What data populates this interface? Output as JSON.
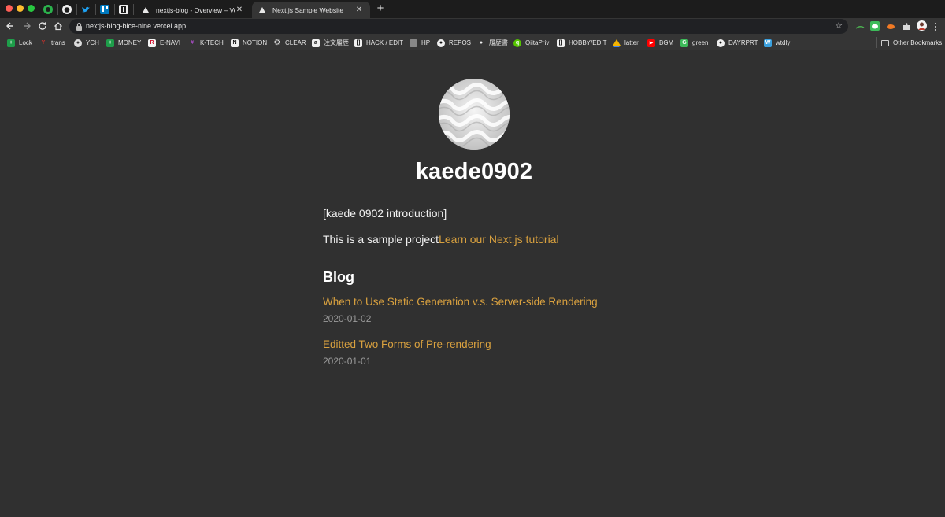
{
  "browser": {
    "tabs": [
      {
        "title": "nextjs-blog - Overview – Vercel",
        "active": false
      },
      {
        "title": "Next.js Sample Website",
        "active": true
      }
    ],
    "tab_close_glyph": "✕",
    "new_tab_glyph": "+",
    "address_bar": {
      "url": "nextjs-blog-bice-nine.vercel.app"
    }
  },
  "bookmarks": [
    {
      "label": "Lock",
      "icon": "green-square-icon",
      "color": "#1e9e4a"
    },
    {
      "label": "trans",
      "icon": "translate-icon",
      "color": "#c4302b"
    },
    {
      "label": "YCH",
      "icon": "globe-icon",
      "color": "#9a9a9a"
    },
    {
      "label": "MONEY",
      "icon": "green-square-icon",
      "color": "#1e9e4a"
    },
    {
      "label": "E-NAVI",
      "icon": "r-icon",
      "color": "#d0102c"
    },
    {
      "label": "K-TECH",
      "icon": "slack-icon",
      "color": "#8e44ad"
    },
    {
      "label": "NOTION",
      "icon": "notion-icon",
      "color": "#f0f0f0"
    },
    {
      "label": "CLEAR",
      "icon": "gear-icon",
      "color": "#dddddd"
    },
    {
      "label": "注文履歴",
      "icon": "amazon-icon",
      "color": "#f0f0f0"
    },
    {
      "label": "HACK / EDIT",
      "icon": "bracket-icon",
      "color": "#f0f0f0"
    },
    {
      "label": "HP",
      "icon": "page-icon",
      "color": "#888888"
    },
    {
      "label": "REPOS",
      "icon": "github-icon",
      "color": "#f0f0f0"
    },
    {
      "label": "履歴書",
      "icon": "bulb-icon",
      "color": "#f0f0f0"
    },
    {
      "label": "QiitaPriv",
      "icon": "qiita-icon",
      "color": "#55c500"
    },
    {
      "label": "HOBBY/EDIT",
      "icon": "bracket-icon",
      "color": "#f0f0f0"
    },
    {
      "label": "latter",
      "icon": "drive-icon",
      "color": "#f4b400"
    },
    {
      "label": "BGM",
      "icon": "youtube-icon",
      "color": "#ff0000"
    },
    {
      "label": "green",
      "icon": "g-icon",
      "color": "#3dbb5a"
    },
    {
      "label": "DAYRPRT",
      "icon": "github-icon",
      "color": "#f0f0f0"
    },
    {
      "label": "wtdly",
      "icon": "w-icon",
      "color": "#3aa1e0"
    }
  ],
  "other_bookmarks": "Other Bookmarks",
  "site": {
    "name": "kaede0902",
    "intro": "[kaede 0902 introduction]",
    "sample_text": "This is a sample project",
    "tutorial_link": "Learn our Next.js tutorial",
    "blog_heading": "Blog",
    "posts": [
      {
        "title": "When to Use Static Generation v.s. Server-side Rendering",
        "date": "2020-01-02"
      },
      {
        "title": "Editted Two Forms of Pre-rendering",
        "date": "2020-01-01"
      }
    ]
  },
  "colors": {
    "page_bg": "#303030",
    "link": "#d9a13f",
    "date": "#9a9a9a"
  }
}
